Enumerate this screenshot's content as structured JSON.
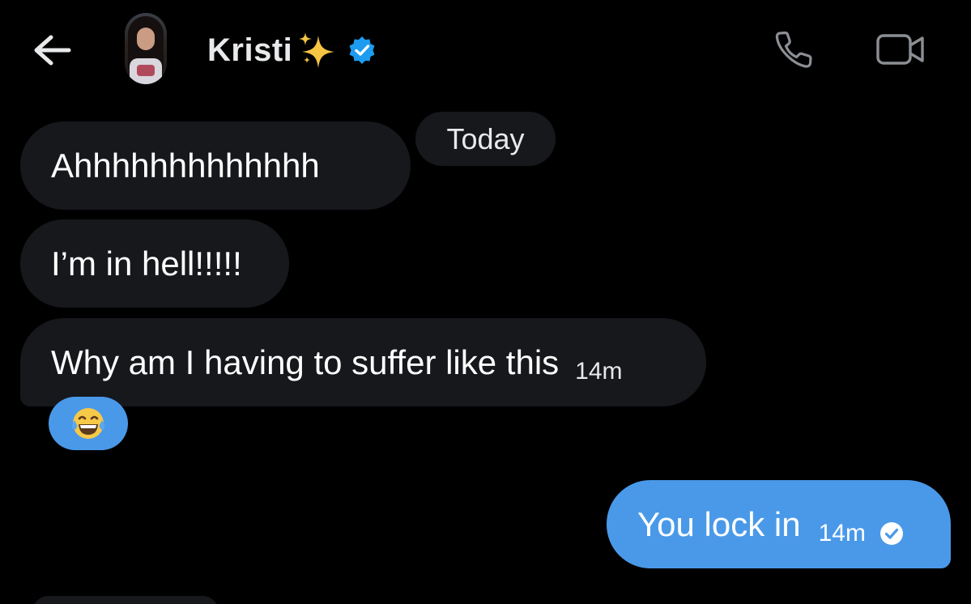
{
  "header": {
    "contact_name": "Kristi",
    "name_emoji": "✨",
    "back_icon": "arrow-left-icon",
    "verified_icon": "verified-badge-icon",
    "call_icon": "phone-icon",
    "video_icon": "video-camera-icon"
  },
  "conversation": {
    "date_separator": "Today",
    "received_messages": [
      {
        "text": "Ahhhhhhhhhhhhh"
      },
      {
        "text": "I’m in hell!!!!!"
      },
      {
        "text": "Why am I having to suffer like this",
        "time": "14m"
      }
    ],
    "reaction": {
      "emoji": "tears-of-joy-emoji"
    },
    "sent_messages": [
      {
        "text": "You lock in",
        "time": "14m",
        "status_icon": "read-check-icon"
      }
    ]
  },
  "colors": {
    "background": "#000000",
    "received_bubble": "#16181c",
    "sent_bubble": "#4a99e9",
    "verified_blue": "#1d9bf0",
    "text": "#e7e9ea",
    "icon_gray": "#8b8f94"
  }
}
